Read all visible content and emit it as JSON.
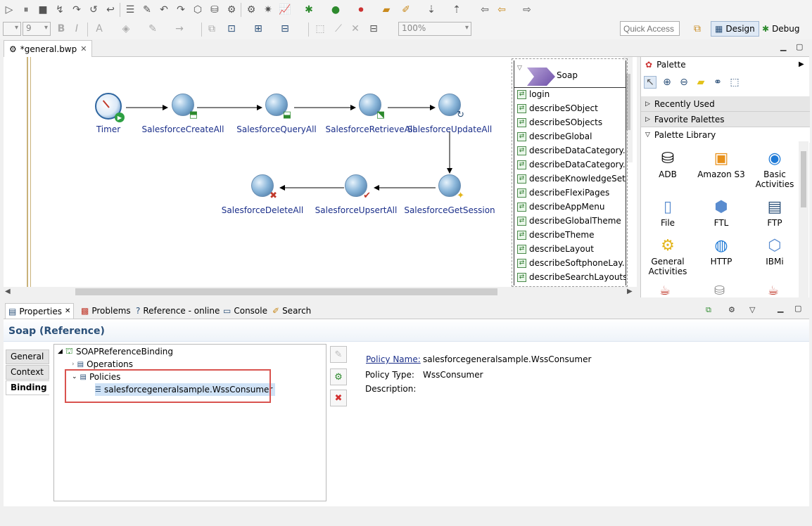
{
  "toolbar": {
    "font_size_value": "9",
    "zoom_value": "100%",
    "quick_access_placeholder": "Quick Access",
    "perspective_design": "Design",
    "perspective_debug": "Debug"
  },
  "editor": {
    "tab_title": "*general.bwp",
    "nodes": [
      {
        "label": "Timer"
      },
      {
        "label": "SalesforceCreateAll"
      },
      {
        "label": "SalesforceQueryAll"
      },
      {
        "label": "SalesforceRetrieveAll"
      },
      {
        "label": "SalesforceUpdateAll"
      },
      {
        "label": "SalesforceGetSession"
      },
      {
        "label": "SalesforceUpsertAll"
      },
      {
        "label": "SalesforceDeleteAll"
      }
    ],
    "reference": {
      "name": "Soap",
      "operations": [
        "login",
        "describeSObject",
        "describeSObjects",
        "describeGlobal",
        "describeDataCategory..",
        "describeDataCategory..",
        "describeKnowledgeSet.",
        "describeFlexiPages",
        "describeAppMenu",
        "describeGlobalTheme",
        "describeTheme",
        "describeLayout",
        "describeSoftphoneLay..",
        "describeSearchLayouts"
      ]
    }
  },
  "palette": {
    "title": "Palette",
    "sections": [
      "Recently Used",
      "Favorite Palettes",
      "Palette Library"
    ],
    "items": [
      "ADB",
      "Amazon S3",
      "Basic Activities",
      "File",
      "FTL",
      "FTP",
      "General Activities",
      "HTTP",
      "IBMi"
    ]
  },
  "properties": {
    "tabs": [
      "Properties",
      "Problems",
      "Reference - online",
      "Console",
      "Search"
    ],
    "title": "Soap (Reference)",
    "side_tabs": [
      "General",
      "Context",
      "Binding"
    ],
    "tree": {
      "root": "SOAPReferenceBinding",
      "operations": "Operations",
      "policies": "Policies",
      "policy_item": "salesforcegeneralsample.WssConsumer"
    },
    "fields": {
      "policy_name_label": "Policy Name:",
      "policy_name_value": "salesforcegeneralsample.WssConsumer",
      "policy_type_label": "Policy Type:",
      "policy_type_value": "WssConsumer",
      "description_label": "Description:"
    }
  },
  "colors": {
    "accent": "#2a4f78",
    "link": "#1b2f8a",
    "highlight_border": "#d9534f",
    "selection": "#cfe2f6"
  }
}
